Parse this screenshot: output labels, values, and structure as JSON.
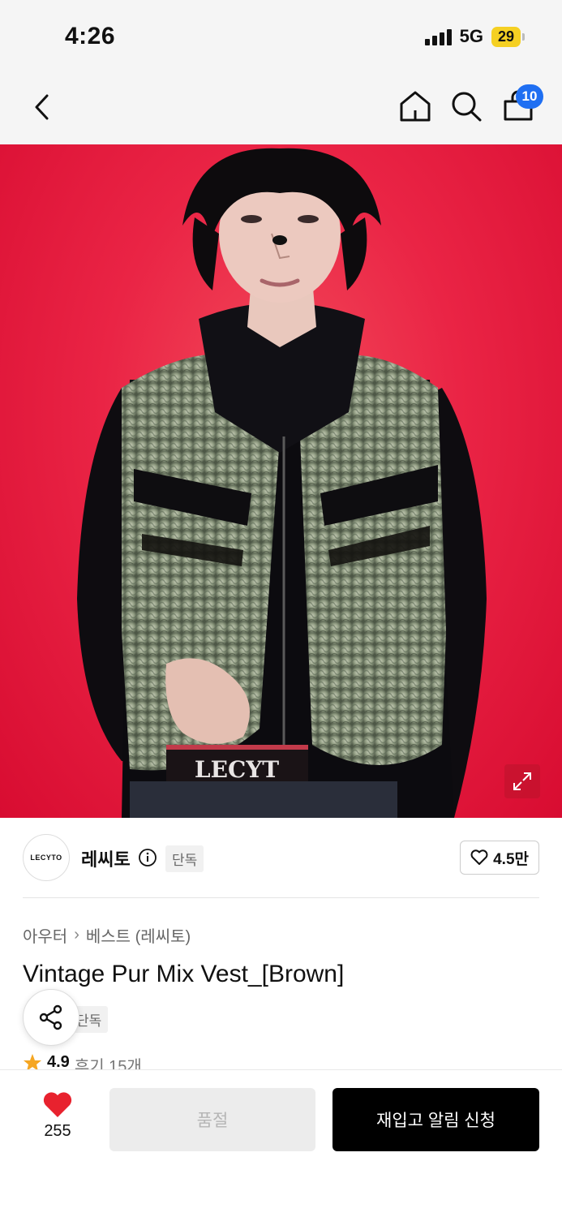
{
  "status_bar": {
    "time": "4:26",
    "network": "5G",
    "battery": "29"
  },
  "nav": {
    "back_icon": "chevron-left-icon",
    "home_icon": "home-icon",
    "search_icon": "search-icon",
    "cart_icon": "shopping-bag-icon",
    "cart_count": "10"
  },
  "hero": {
    "zoom_icon": "expand-icon",
    "background_color": "#e8223f",
    "waistband_text": "LECYT"
  },
  "brand": {
    "logo_text": "LECYTO",
    "name": "레씨토",
    "info_icon": "info-icon",
    "tag": "단독",
    "favorite_icon": "heart-outline-icon",
    "favorite_count": "4.5만"
  },
  "breadcrumb": {
    "items": [
      "아우터",
      "베스트 (레씨토)"
    ],
    "separator": "›"
  },
  "product": {
    "title": "Vintage Pur Mix Vest_[Brown]",
    "tag": "단독",
    "rating": "4.9",
    "reviews": "후기 15개"
  },
  "share": {
    "icon": "share-icon"
  },
  "bottom_bar": {
    "like_icon": "heart-filled-icon",
    "like_count": "255",
    "sold_out_label": "품절",
    "restock_label": "재입고 알림 신청",
    "accent_color": "#e8222e"
  }
}
